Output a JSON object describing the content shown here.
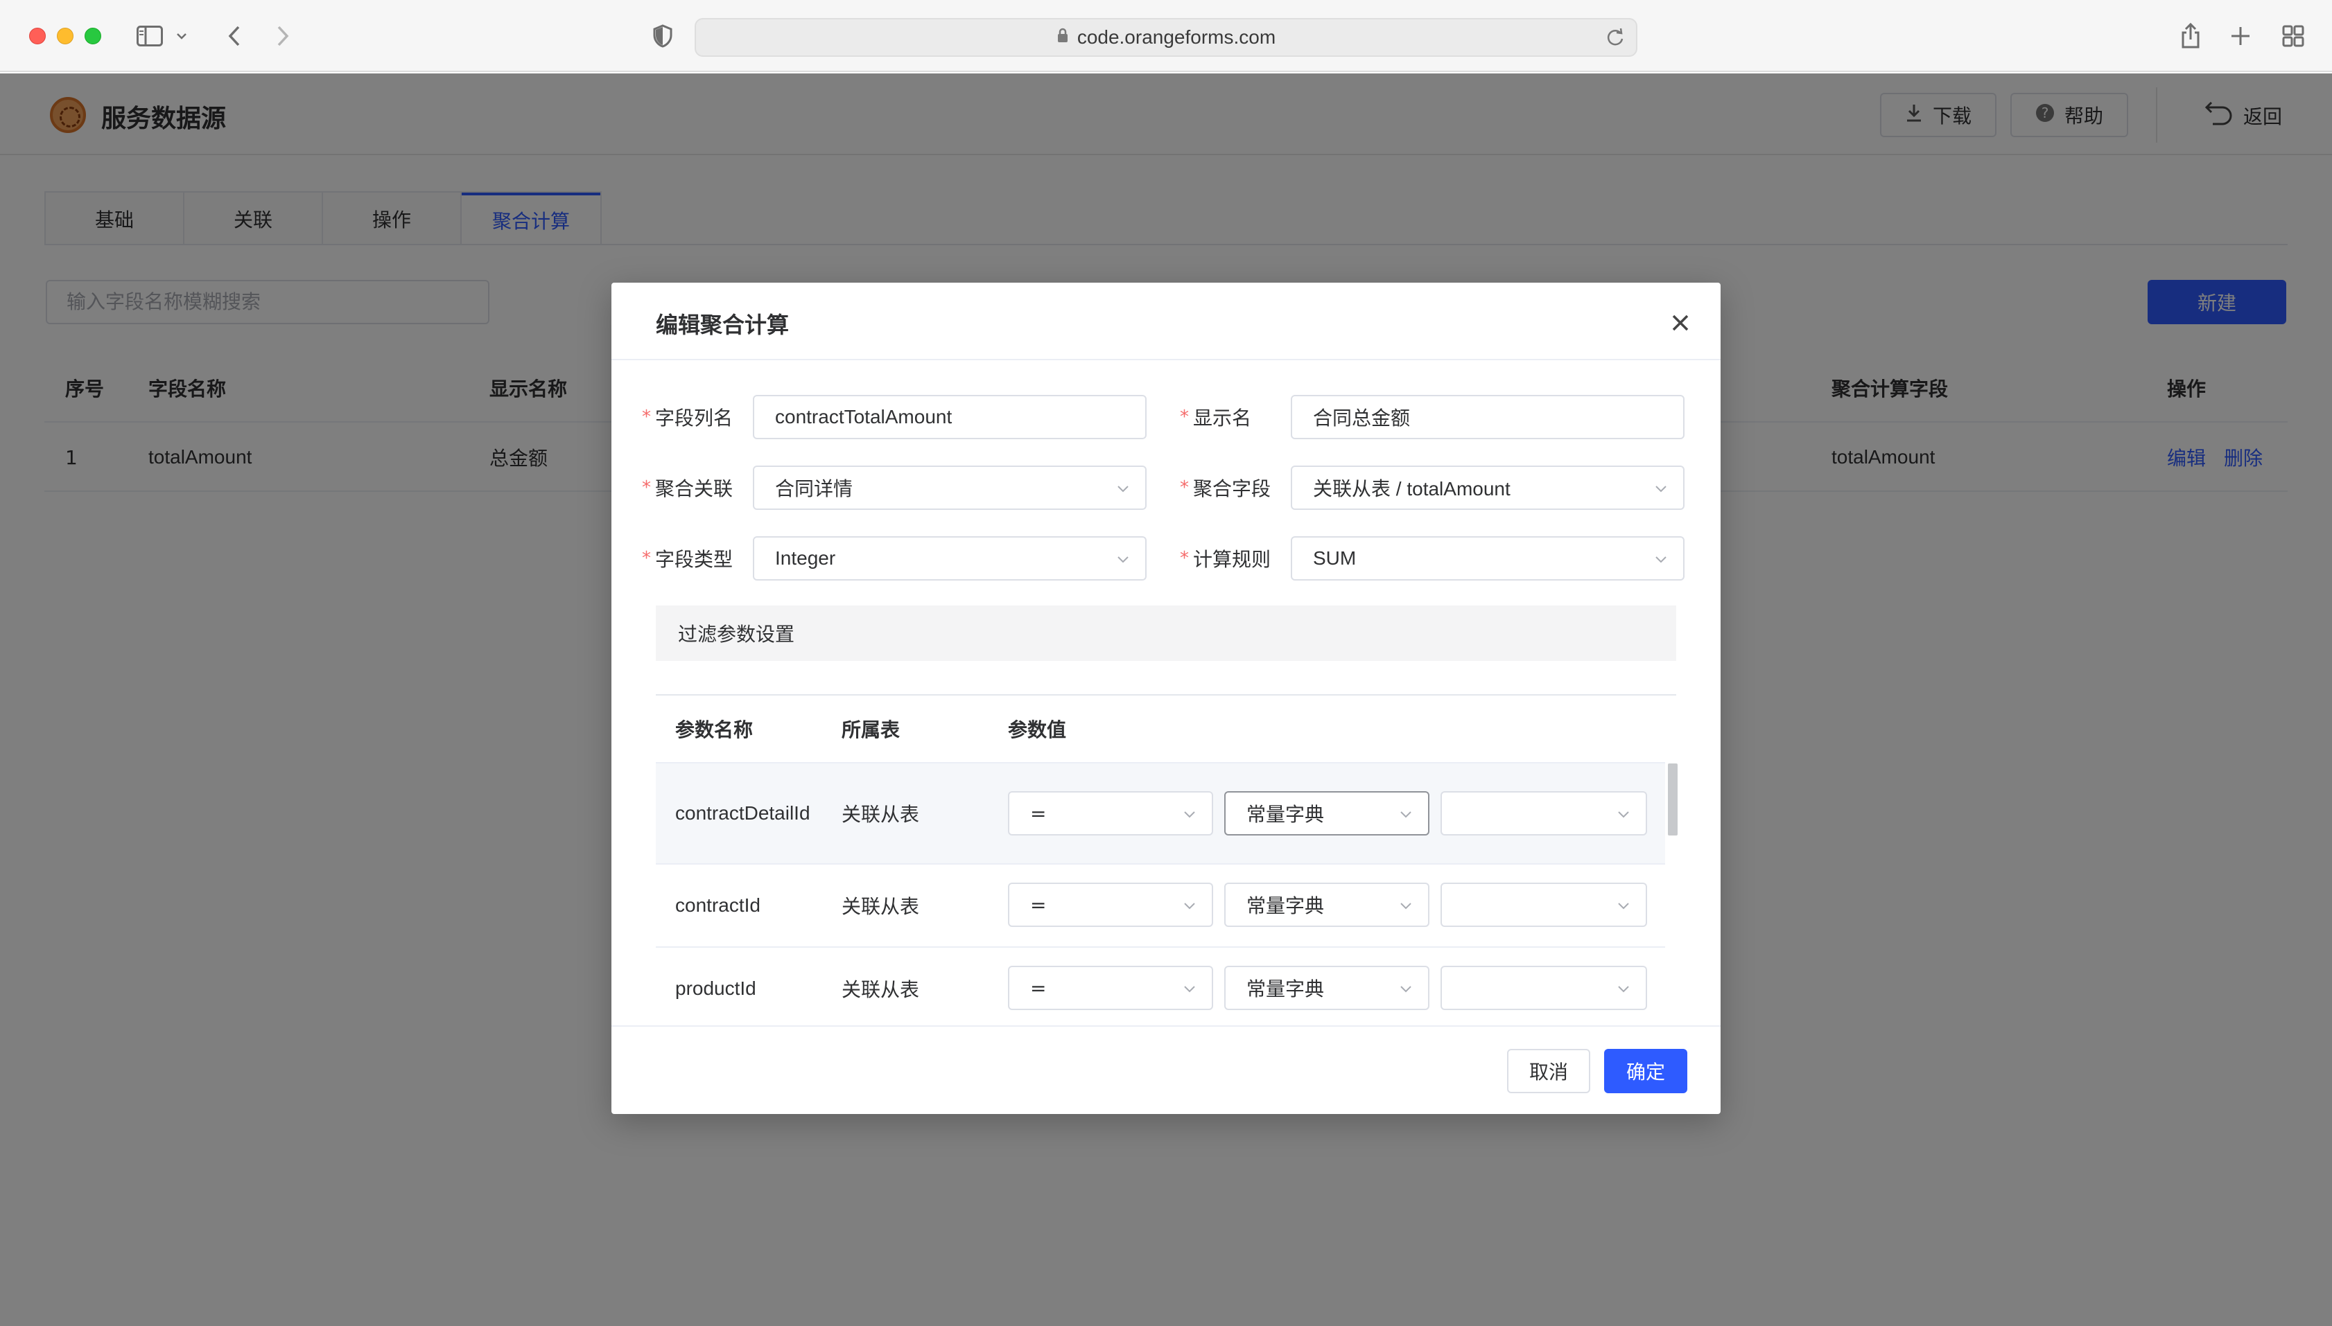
{
  "browser": {
    "url": "code.orangeforms.com"
  },
  "app": {
    "title": "服务数据源",
    "download_label": "下载",
    "help_label": "帮助",
    "back_label": "返回",
    "tabs": [
      {
        "label": "基础"
      },
      {
        "label": "关联"
      },
      {
        "label": "操作"
      },
      {
        "label": "聚合计算",
        "active": true
      }
    ],
    "search_placeholder": "输入字段名称模糊搜索",
    "new_label": "新建",
    "table": {
      "headers": {
        "index": "序号",
        "field_name": "字段名称",
        "display_name": "显示名称",
        "agg_field": "聚合计算字段",
        "actions": "操作"
      },
      "rows": [
        {
          "index": "1",
          "field_name": "totalAmount",
          "display_name": "总金额",
          "agg_field": "totalAmount",
          "edit": "编辑",
          "delete": "删除"
        }
      ]
    }
  },
  "dialog": {
    "title": "编辑聚合计算",
    "form": {
      "column_name_label": "字段列名",
      "column_name_value": "contractTotalAmount",
      "display_name_label": "显示名",
      "display_name_value": "合同总金额",
      "agg_relation_label": "聚合关联",
      "agg_relation_value": "合同详情",
      "agg_field_label": "聚合字段",
      "agg_field_value": "关联从表 / totalAmount",
      "field_type_label": "字段类型",
      "field_type_value": "Integer",
      "calc_rule_label": "计算规则",
      "calc_rule_value": "SUM"
    },
    "filter_section_title": "过滤参数设置",
    "params": {
      "headers": {
        "name": "参数名称",
        "table": "所属表",
        "value": "参数值"
      },
      "rows": [
        {
          "name": "contractDetailId",
          "table": "关联从表",
          "op": "=",
          "source": "常量字典",
          "value": ""
        },
        {
          "name": "contractId",
          "table": "关联从表",
          "op": "=",
          "source": "常量字典",
          "value": ""
        },
        {
          "name": "productId",
          "table": "关联从表",
          "op": "=",
          "source": "常量字典",
          "value": ""
        }
      ]
    },
    "cancel_label": "取消",
    "confirm_label": "确定"
  },
  "colors": {
    "primary": "#2e5bff",
    "required": "#f56c6c",
    "overlay": "rgba(0,0,0,0.5)"
  }
}
